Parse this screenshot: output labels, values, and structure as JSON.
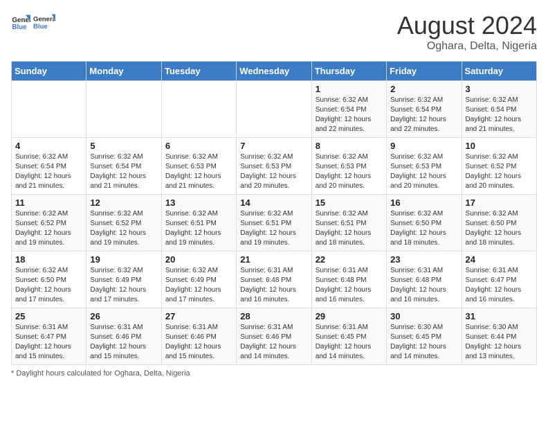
{
  "header": {
    "logo_general": "General",
    "logo_blue": "Blue",
    "month_year": "August 2024",
    "location": "Oghara, Delta, Nigeria"
  },
  "days_of_week": [
    "Sunday",
    "Monday",
    "Tuesday",
    "Wednesday",
    "Thursday",
    "Friday",
    "Saturday"
  ],
  "footer": {
    "note": "Daylight hours"
  },
  "weeks": [
    [
      {
        "day": "",
        "info": ""
      },
      {
        "day": "",
        "info": ""
      },
      {
        "day": "",
        "info": ""
      },
      {
        "day": "",
        "info": ""
      },
      {
        "day": "1",
        "info": "Sunrise: 6:32 AM\nSunset: 6:54 PM\nDaylight: 12 hours\nand 22 minutes."
      },
      {
        "day": "2",
        "info": "Sunrise: 6:32 AM\nSunset: 6:54 PM\nDaylight: 12 hours\nand 22 minutes."
      },
      {
        "day": "3",
        "info": "Sunrise: 6:32 AM\nSunset: 6:54 PM\nDaylight: 12 hours\nand 21 minutes."
      }
    ],
    [
      {
        "day": "4",
        "info": "Sunrise: 6:32 AM\nSunset: 6:54 PM\nDaylight: 12 hours\nand 21 minutes."
      },
      {
        "day": "5",
        "info": "Sunrise: 6:32 AM\nSunset: 6:54 PM\nDaylight: 12 hours\nand 21 minutes."
      },
      {
        "day": "6",
        "info": "Sunrise: 6:32 AM\nSunset: 6:53 PM\nDaylight: 12 hours\nand 21 minutes."
      },
      {
        "day": "7",
        "info": "Sunrise: 6:32 AM\nSunset: 6:53 PM\nDaylight: 12 hours\nand 20 minutes."
      },
      {
        "day": "8",
        "info": "Sunrise: 6:32 AM\nSunset: 6:53 PM\nDaylight: 12 hours\nand 20 minutes."
      },
      {
        "day": "9",
        "info": "Sunrise: 6:32 AM\nSunset: 6:53 PM\nDaylight: 12 hours\nand 20 minutes."
      },
      {
        "day": "10",
        "info": "Sunrise: 6:32 AM\nSunset: 6:52 PM\nDaylight: 12 hours\nand 20 minutes."
      }
    ],
    [
      {
        "day": "11",
        "info": "Sunrise: 6:32 AM\nSunset: 6:52 PM\nDaylight: 12 hours\nand 19 minutes."
      },
      {
        "day": "12",
        "info": "Sunrise: 6:32 AM\nSunset: 6:52 PM\nDaylight: 12 hours\nand 19 minutes."
      },
      {
        "day": "13",
        "info": "Sunrise: 6:32 AM\nSunset: 6:51 PM\nDaylight: 12 hours\nand 19 minutes."
      },
      {
        "day": "14",
        "info": "Sunrise: 6:32 AM\nSunset: 6:51 PM\nDaylight: 12 hours\nand 19 minutes."
      },
      {
        "day": "15",
        "info": "Sunrise: 6:32 AM\nSunset: 6:51 PM\nDaylight: 12 hours\nand 18 minutes."
      },
      {
        "day": "16",
        "info": "Sunrise: 6:32 AM\nSunset: 6:50 PM\nDaylight: 12 hours\nand 18 minutes."
      },
      {
        "day": "17",
        "info": "Sunrise: 6:32 AM\nSunset: 6:50 PM\nDaylight: 12 hours\nand 18 minutes."
      }
    ],
    [
      {
        "day": "18",
        "info": "Sunrise: 6:32 AM\nSunset: 6:50 PM\nDaylight: 12 hours\nand 17 minutes."
      },
      {
        "day": "19",
        "info": "Sunrise: 6:32 AM\nSunset: 6:49 PM\nDaylight: 12 hours\nand 17 minutes."
      },
      {
        "day": "20",
        "info": "Sunrise: 6:32 AM\nSunset: 6:49 PM\nDaylight: 12 hours\nand 17 minutes."
      },
      {
        "day": "21",
        "info": "Sunrise: 6:31 AM\nSunset: 6:48 PM\nDaylight: 12 hours\nand 16 minutes."
      },
      {
        "day": "22",
        "info": "Sunrise: 6:31 AM\nSunset: 6:48 PM\nDaylight: 12 hours\nand 16 minutes."
      },
      {
        "day": "23",
        "info": "Sunrise: 6:31 AM\nSunset: 6:48 PM\nDaylight: 12 hours\nand 16 minutes."
      },
      {
        "day": "24",
        "info": "Sunrise: 6:31 AM\nSunset: 6:47 PM\nDaylight: 12 hours\nand 16 minutes."
      }
    ],
    [
      {
        "day": "25",
        "info": "Sunrise: 6:31 AM\nSunset: 6:47 PM\nDaylight: 12 hours\nand 15 minutes."
      },
      {
        "day": "26",
        "info": "Sunrise: 6:31 AM\nSunset: 6:46 PM\nDaylight: 12 hours\nand 15 minutes."
      },
      {
        "day": "27",
        "info": "Sunrise: 6:31 AM\nSunset: 6:46 PM\nDaylight: 12 hours\nand 15 minutes."
      },
      {
        "day": "28",
        "info": "Sunrise: 6:31 AM\nSunset: 6:46 PM\nDaylight: 12 hours\nand 14 minutes."
      },
      {
        "day": "29",
        "info": "Sunrise: 6:31 AM\nSunset: 6:45 PM\nDaylight: 12 hours\nand 14 minutes."
      },
      {
        "day": "30",
        "info": "Sunrise: 6:30 AM\nSunset: 6:45 PM\nDaylight: 12 hours\nand 14 minutes."
      },
      {
        "day": "31",
        "info": "Sunrise: 6:30 AM\nSunset: 6:44 PM\nDaylight: 12 hours\nand 13 minutes."
      }
    ]
  ]
}
